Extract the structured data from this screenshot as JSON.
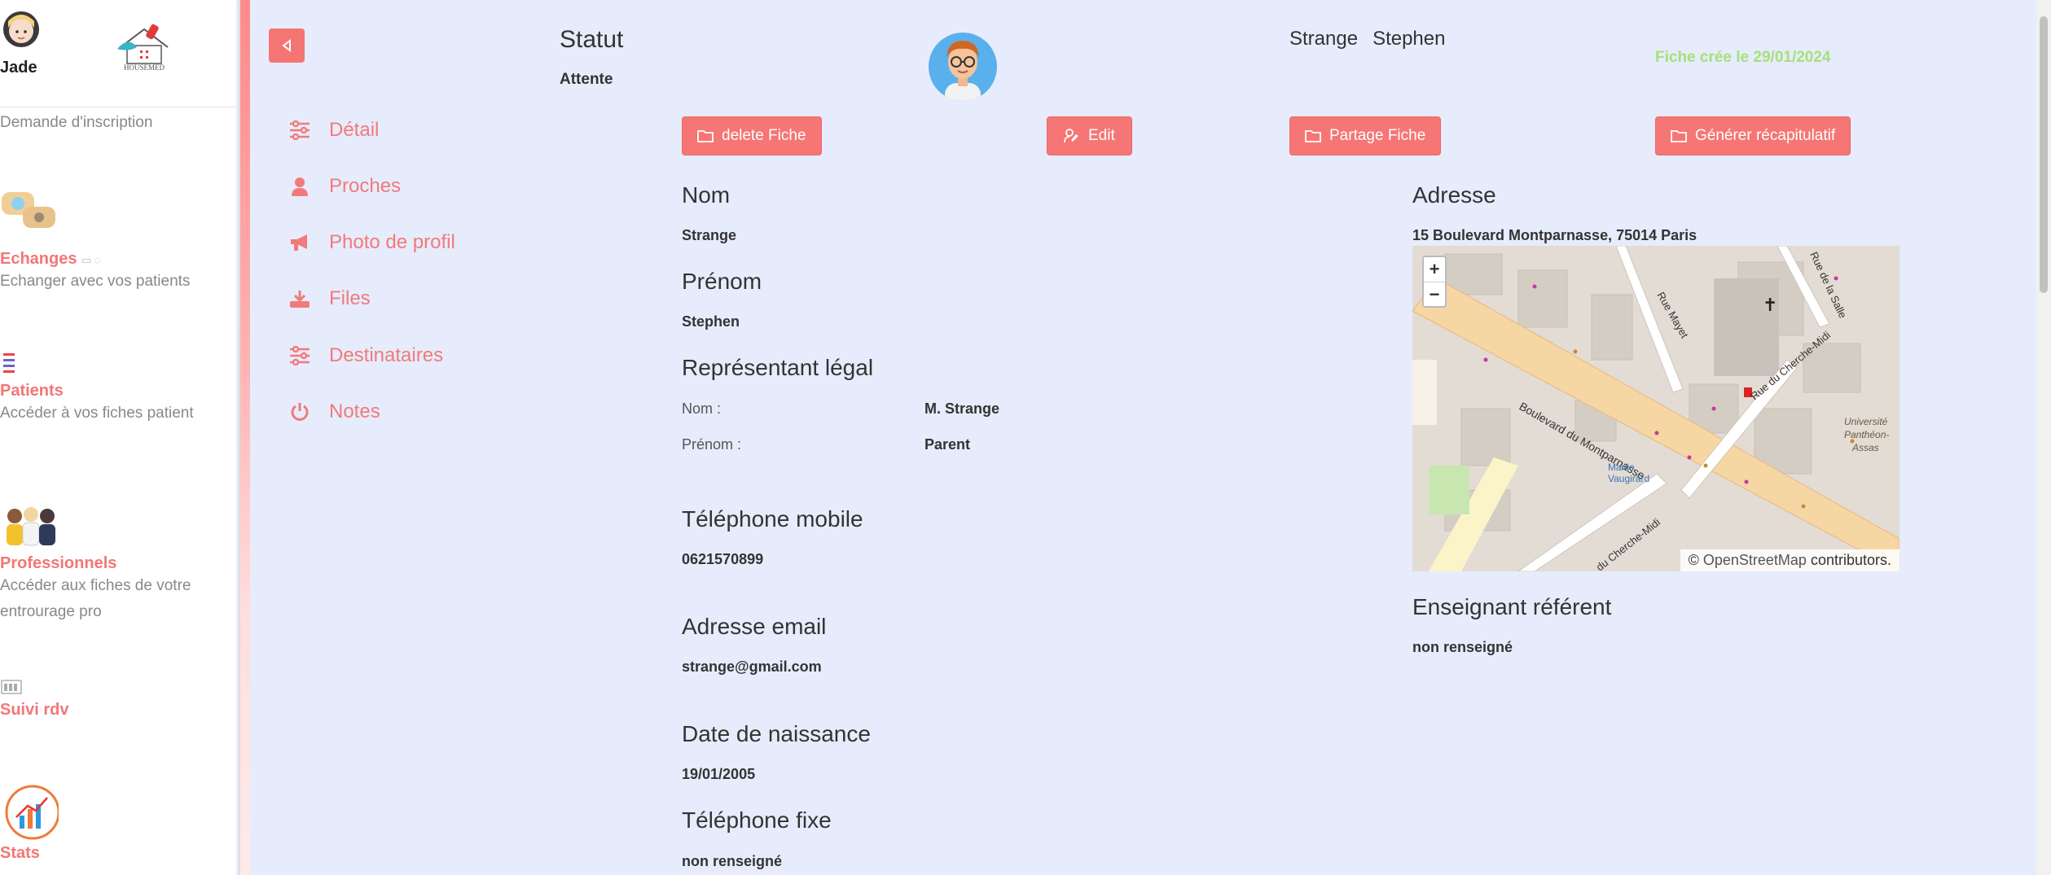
{
  "sidebar": {
    "user_name": "Jade",
    "logo_text": "HOUSEMED",
    "top_link": "Demande d'inscription",
    "sections": [
      {
        "title": "Echanges",
        "desc": "Echanger avec vos patients"
      },
      {
        "title": "Patients",
        "desc": "Accéder à vos fiches patient"
      },
      {
        "title": "Professionnels",
        "desc": "Accéder aux fiches de votre entrourage pro"
      },
      {
        "title": "Suivi rdv",
        "desc": ""
      },
      {
        "title": "Stats",
        "desc": ""
      }
    ]
  },
  "nav": {
    "items": [
      {
        "label": "Détail",
        "icon": "sliders-icon"
      },
      {
        "label": "Proches",
        "icon": "person-icon"
      },
      {
        "label": "Photo de profil",
        "icon": "megaphone-icon"
      },
      {
        "label": "Files",
        "icon": "download-icon"
      },
      {
        "label": "Destinataires",
        "icon": "sliders-icon"
      },
      {
        "label": "Notes",
        "icon": "power-icon"
      }
    ]
  },
  "header": {
    "statut_label": "Statut",
    "statut_value": "Attente",
    "last_name": "Strange",
    "first_name": "Stephen",
    "fiche_date": "Fiche crée le 29/01/2024"
  },
  "actions": {
    "delete": "delete Fiche",
    "edit": "Edit",
    "share": "Partage Fiche",
    "summary": "Générer récapitulatif"
  },
  "fields": {
    "nom_label": "Nom",
    "nom_value": "Strange",
    "prenom_label": "Prénom",
    "prenom_value": "Stephen",
    "rep_label": "Représentant légal",
    "rep_nom_label": "Nom :",
    "rep_nom_value": "M. Strange",
    "rep_prenom_label": "Prénom :",
    "rep_prenom_value": "Parent",
    "mobile_label": "Téléphone mobile",
    "mobile_value": "0621570899",
    "email_label": "Adresse email",
    "email_value": "strange@gmail.com",
    "dob_label": "Date de naissance",
    "dob_value": "19/01/2005",
    "fixe_label": "Téléphone fixe",
    "fixe_value": "non renseigné",
    "adresse_label": "Adresse",
    "adresse_value": "15 Boulevard Montparnasse, 75014 Paris",
    "enseignant_label": "Enseignant référent",
    "enseignant_value": "non renseigné"
  },
  "map": {
    "zoom_in": "+",
    "zoom_out": "−",
    "attr_prefix": "©",
    "attr_link": "OpenStreetMap",
    "attr_suffix": "contributors.",
    "streets": [
      "Boulevard du Montparnasse",
      "Rue du Cherche-Midi",
      "Rue Mayet",
      "Rue de la Salle",
      "du Cherche-Midi",
      "Université Panthéon-Assas",
      "Mairie Vaugirard"
    ]
  }
}
